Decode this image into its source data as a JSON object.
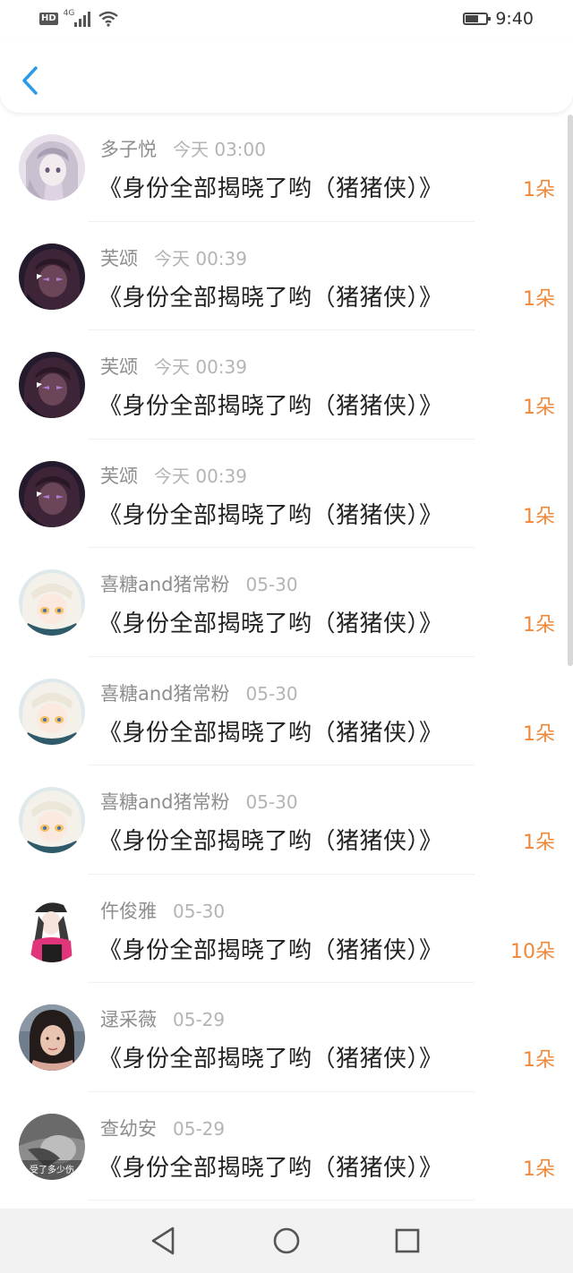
{
  "status_bar": {
    "hd": "HD",
    "network": "4G",
    "time": "9:40"
  },
  "header": {
    "back_icon": "chevron-left-icon",
    "accent_color": "#2c9be6"
  },
  "colors": {
    "count": "#f0883a",
    "name": "#8e8e8e",
    "time": "#b4b4b4",
    "title": "#222222"
  },
  "rows": [
    {
      "name": "多子悦",
      "time": "今天 03:00",
      "title": "《身份全部揭晓了哟（猪猪侠）》",
      "count": "1朵",
      "avatar": "anime-girl-avatar-light"
    },
    {
      "name": "芙颂",
      "time": "今天 00:39",
      "title": "《身份全部揭晓了哟（猪猪侠）》",
      "count": "1朵",
      "avatar": "anime-girl-avatar-dark"
    },
    {
      "name": "芙颂",
      "time": "今天 00:39",
      "title": "《身份全部揭晓了哟（猪猪侠）》",
      "count": "1朵",
      "avatar": "anime-girl-avatar-dark"
    },
    {
      "name": "芙颂",
      "time": "今天 00:39",
      "title": "《身份全部揭晓了哟（猪猪侠）》",
      "count": "1朵",
      "avatar": "anime-girl-avatar-dark"
    },
    {
      "name": "喜糖and猪常粉",
      "time": "05-30",
      "title": "《身份全部揭晓了哟（猪猪侠）》",
      "count": "1朵",
      "avatar": "anime-white-hair-avatar"
    },
    {
      "name": "喜糖and猪常粉",
      "time": "05-30",
      "title": "《身份全部揭晓了哟（猪猪侠）》",
      "count": "1朵",
      "avatar": "anime-white-hair-avatar"
    },
    {
      "name": "喜糖and猪常粉",
      "time": "05-30",
      "title": "《身份全部揭晓了哟（猪猪侠）》",
      "count": "1朵",
      "avatar": "anime-white-hair-avatar"
    },
    {
      "name": "仵俊雅",
      "time": "05-30",
      "title": "《身份全部揭晓了哟（猪猪侠）》",
      "count": "10朵",
      "avatar": "cap-girl-avatar"
    },
    {
      "name": "逯采薇",
      "time": "05-29",
      "title": "《身份全部揭晓了哟（猪猪侠）》",
      "count": "1朵",
      "avatar": "photo-girl-avatar"
    },
    {
      "name": "查幼安",
      "time": "05-29",
      "title": "《身份全部揭晓了哟（猪猪侠）》",
      "count": "1朵",
      "avatar": "grayscale-photo-avatar",
      "avatar_caption": "受了多少伤"
    }
  ],
  "navbar": {
    "back": "triangle-back-icon",
    "home": "circle-home-icon",
    "recents": "square-recents-icon"
  }
}
